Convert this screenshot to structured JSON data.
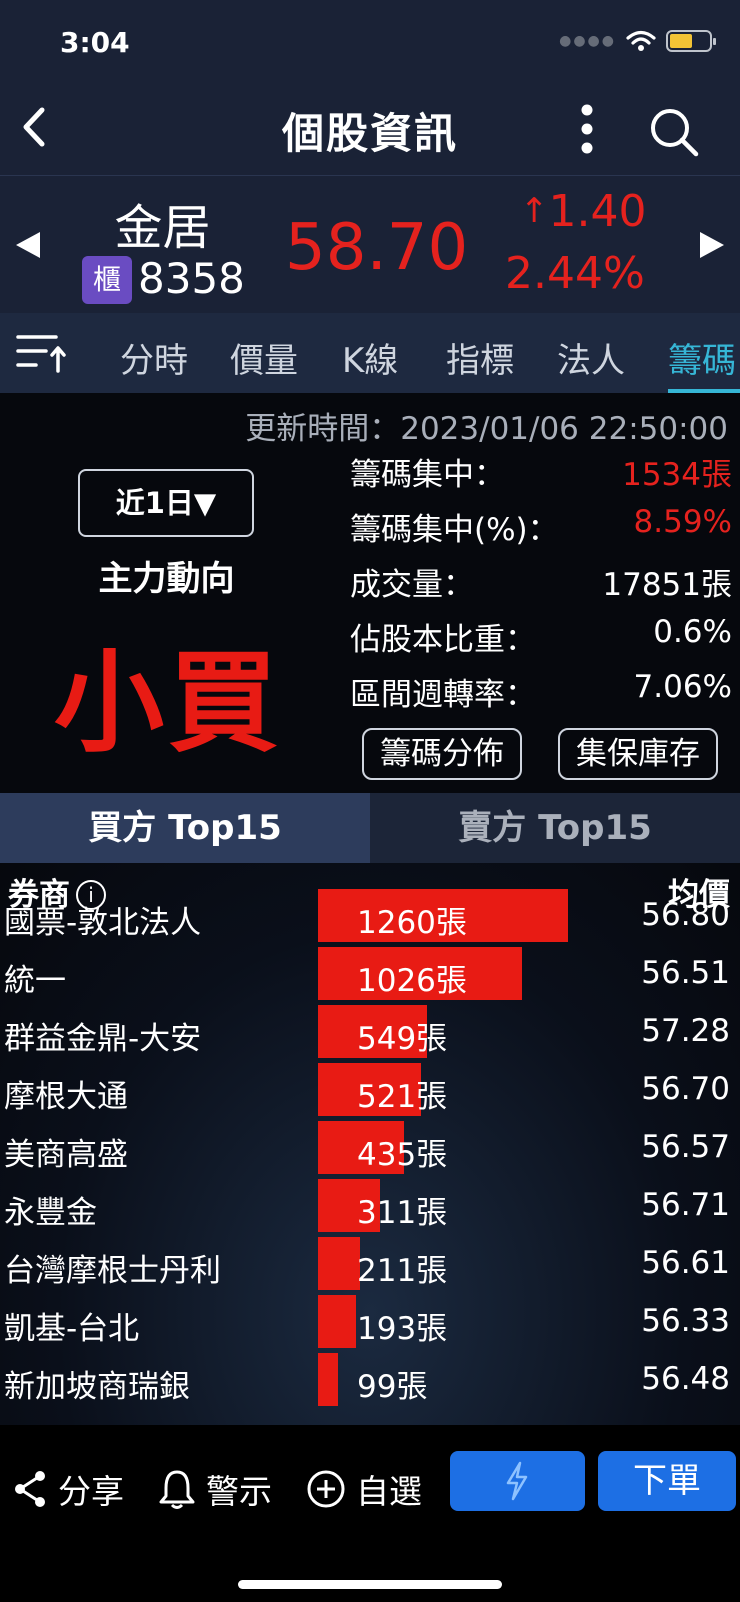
{
  "status": {
    "time": "3:04"
  },
  "nav": {
    "title": "個股資訊"
  },
  "stock": {
    "name": "金居",
    "market_badge": "櫃",
    "code": "8358",
    "price": "58.70",
    "change": "1.40",
    "change_arrow": "↑",
    "change_pct": "2.44%",
    "up_color": "#e5221e"
  },
  "tabs": [
    {
      "label": "分時"
    },
    {
      "label": "價量"
    },
    {
      "label": "K線"
    },
    {
      "label": "指標"
    },
    {
      "label": "法人"
    },
    {
      "label": "籌碼",
      "active": true
    }
  ],
  "chips": {
    "update_time": "更新時間：2023/01/06 22:50:00",
    "period": "近1日▼",
    "trend_label": "主力動向",
    "trend_value": "小買",
    "metrics": [
      {
        "label": "籌碼集中：",
        "value": "1534張",
        "red": true
      },
      {
        "label": "籌碼集中(%)：",
        "value": "8.59%",
        "red": true
      },
      {
        "label": "成交量：",
        "value": "17851張",
        "red": false
      },
      {
        "label": "佔股本比重：",
        "value": "0.6%",
        "red": false
      },
      {
        "label": "區間週轉率：",
        "value": "7.06%",
        "red": false
      }
    ],
    "dist_button": "籌碼分佈",
    "depository_button": "集保庫存"
  },
  "side_tabs": {
    "buy": "買方 Top15",
    "sell": "賣方 Top15"
  },
  "table": {
    "broker_header": "券商",
    "info_glyph": "i",
    "avg_header": "均價",
    "rows": [
      {
        "broker": "國票-敦北法人",
        "volume": 1260,
        "unit": "張",
        "avg": "56.80"
      },
      {
        "broker": "統一",
        "volume": 1026,
        "unit": "張",
        "avg": "56.51"
      },
      {
        "broker": "群益金鼎-大安",
        "volume": 549,
        "unit": "張",
        "avg": "57.28"
      },
      {
        "broker": "摩根大通",
        "volume": 521,
        "unit": "張",
        "avg": "56.70"
      },
      {
        "broker": "美商高盛",
        "volume": 435,
        "unit": "張",
        "avg": "56.57"
      },
      {
        "broker": "永豐金",
        "volume": 311,
        "unit": "張",
        "avg": "56.71"
      },
      {
        "broker": "台灣摩根士丹利",
        "volume": 211,
        "unit": "張",
        "avg": "56.61"
      },
      {
        "broker": "凱基-台北",
        "volume": 193,
        "unit": "張",
        "avg": "56.33"
      },
      {
        "broker": "新加坡商瑞銀",
        "volume": 99,
        "unit": "張",
        "avg": "56.48"
      }
    ]
  },
  "bottom": {
    "share": "分享",
    "alert": "警示",
    "watchlist": "自選",
    "order": "下單"
  },
  "icons": {
    "back": "chevron-left-icon",
    "more": "more-vertical-icon",
    "search": "search-icon",
    "menu": "sort-menu-icon",
    "share": "share-icon",
    "alert": "bell-icon",
    "watchlist": "plus-circle-icon",
    "flash": "lightning-icon"
  }
}
